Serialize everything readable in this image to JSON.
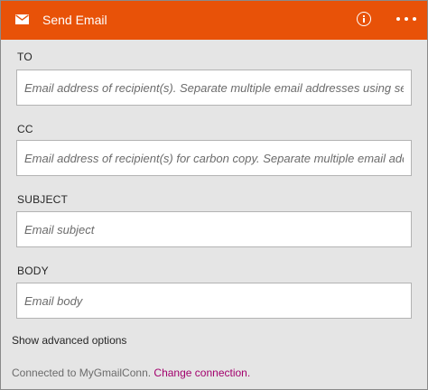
{
  "header": {
    "title": "Send Email",
    "icons": {
      "leading": "mail-icon",
      "info": "info-icon",
      "more": "more-icon"
    },
    "color": "#e85208"
  },
  "fields": {
    "to": {
      "label": "TO",
      "placeholder": "Email address of recipient(s). Separate multiple email addresses using semicolons."
    },
    "cc": {
      "label": "CC",
      "placeholder": "Email address of recipient(s) for carbon copy. Separate multiple email addresses using semicolons."
    },
    "subject": {
      "label": "SUBJECT",
      "placeholder": "Email subject"
    },
    "body": {
      "label": "BODY",
      "placeholder": "Email body"
    }
  },
  "advanced_options_label": "Show advanced options",
  "footer": {
    "connected_text": "Connected to MyGmailConn.",
    "change_link": "Change connection."
  }
}
